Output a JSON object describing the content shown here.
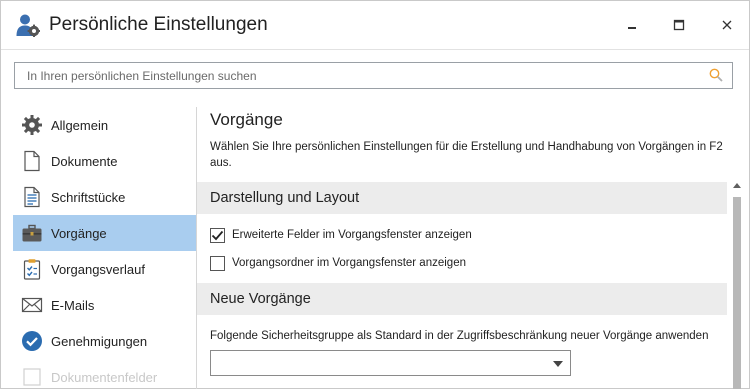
{
  "window": {
    "title": "Persönliche Einstellungen",
    "controls": [
      "minimize",
      "maximize",
      "close"
    ]
  },
  "search": {
    "placeholder": "In Ihren persönlichen Einstellungen suchen",
    "value": ""
  },
  "sidebar": {
    "items": [
      {
        "label": "Allgemein",
        "icon": "gear-icon",
        "active": false
      },
      {
        "label": "Dokumente",
        "icon": "document-icon",
        "active": false
      },
      {
        "label": "Schriftstücke",
        "icon": "text-document-icon",
        "active": false
      },
      {
        "label": "Vorgänge",
        "icon": "briefcase-icon",
        "active": true
      },
      {
        "label": "Vorgangsverlauf",
        "icon": "clipboard-checklist-icon",
        "active": false
      },
      {
        "label": "E-Mails",
        "icon": "envelope-icon",
        "active": false
      },
      {
        "label": "Genehmigungen",
        "icon": "checkmark-circle-icon",
        "active": false
      },
      {
        "label": "Dokumentenfelder",
        "icon": "fields-icon",
        "active": false
      }
    ]
  },
  "main": {
    "title": "Vorgänge",
    "description": "Wählen Sie Ihre persönlichen Einstellungen für die Erstellung und Handhabung von Vorgängen in F2 aus.",
    "sections": [
      {
        "title": "Darstellung und Layout",
        "options": [
          {
            "label": "Erweiterte Felder im Vorgangsfenster anzeigen",
            "checked": true
          },
          {
            "label": "Vorgangsordner im Vorgangsfenster anzeigen",
            "checked": false
          }
        ]
      },
      {
        "title": "Neue Vorgänge",
        "field_label": "Folgende Sicherheitsgruppe als Standard in der Zugriffsbeschränkung neuer Vorgänge anwenden",
        "dropdown_value": ""
      }
    ]
  },
  "colors": {
    "active_nav": "#a9cdef",
    "section_header_bg": "#ececec",
    "accent_blue": "#2b6cb0"
  }
}
